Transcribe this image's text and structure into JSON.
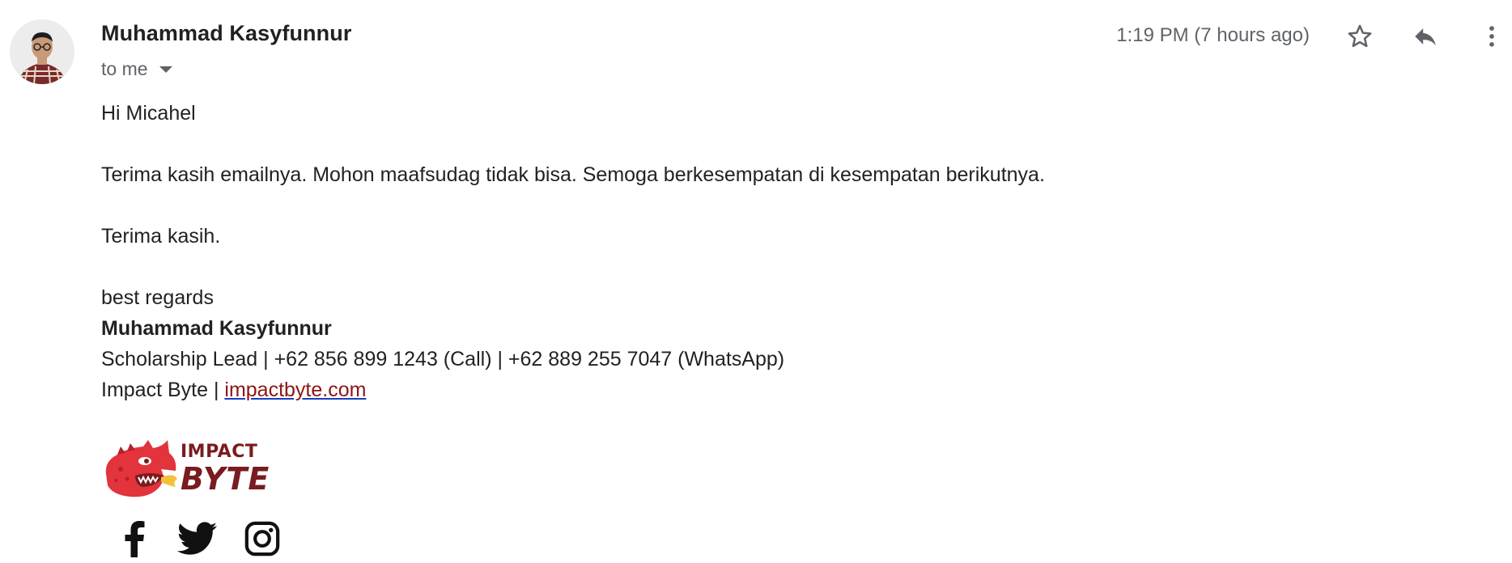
{
  "message": {
    "sender_name": "Muhammad Kasyfunnur",
    "recipient_label": "to me",
    "timestamp": "1:19 PM (7 hours ago)",
    "icons": {
      "star": "star-outline-icon",
      "reply": "reply-icon",
      "more": "more-vertical-icon",
      "recipient_dropdown": "caret-down-icon"
    }
  },
  "body": {
    "greeting": "Hi Micahel",
    "paragraph_1": "Terima kasih emailnya. Mohon maafsudag tidak bisa. Semoga berkesempatan di kesempatan berikutnya.",
    "paragraph_2": "Terima kasih.",
    "closing": "best regards"
  },
  "signature": {
    "name": "Muhammad Kasyfunnur",
    "line1": "Scholarship Lead | +62 856 899 1243 (Call) | +62 889 255 7047 (WhatsApp)",
    "company": "Impact Byte | ",
    "link_text": "impactbyte.com",
    "logo_text_top": "IMPACT",
    "logo_text_bottom": "BYTE",
    "social": {
      "facebook": "facebook-icon",
      "twitter": "twitter-icon",
      "instagram": "instagram-icon"
    }
  },
  "colors": {
    "logo_red": "#e3333c",
    "logo_dark": "#7a1b1f",
    "link": "#8b1616",
    "meta_gray": "#5f6368"
  }
}
